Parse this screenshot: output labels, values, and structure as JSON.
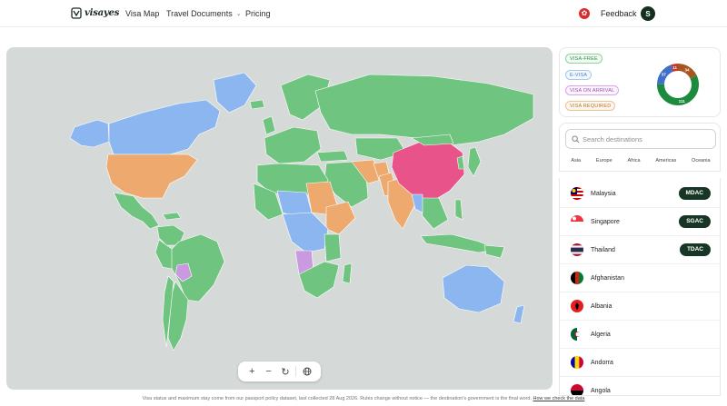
{
  "brand": {
    "name": "visayes"
  },
  "nav": {
    "links": [
      "Visa Map",
      "Travel Documents",
      "Pricing"
    ],
    "feedback": "Feedback",
    "avatar_initial": "S"
  },
  "legend": {
    "pills": [
      "VISA-FREE",
      "E-VISA",
      "VISA ON ARRIVAL",
      "VISA REQUIRED"
    ],
    "colors": {
      "visa_free": "#6fc47f",
      "e_visa": "#8bb6ef",
      "visa_on_arrival": "#c99ae0",
      "visa_required": "#eeaa6e",
      "selected": "#e8538a",
      "brown": "#a8551f"
    },
    "donut": [
      {
        "label": "34",
        "value": 34,
        "color": "#a8551f"
      },
      {
        "label": "111",
        "value": 111,
        "color": "#1e8a3e"
      },
      {
        "label": "37",
        "value": 37,
        "color": "#3e6fc9"
      },
      {
        "label": "11",
        "value": 11,
        "color": "#c0392b"
      }
    ]
  },
  "search": {
    "placeholder": "Search destinations"
  },
  "regions": [
    "Asia",
    "Europe",
    "Africa",
    "Americas",
    "Oceania"
  ],
  "destinations": [
    {
      "name": "Malaysia",
      "badge": "MDAC",
      "flag": "malaysia-flag-icon"
    },
    {
      "name": "Singapore",
      "badge": "SGAC",
      "flag": "singapore-flag-icon"
    },
    {
      "name": "Thailand",
      "badge": "TDAC",
      "flag": "thailand-flag-icon"
    },
    {
      "name": "Afghanistan",
      "badge": "",
      "flag": "afghanistan-flag-icon"
    },
    {
      "name": "Albania",
      "badge": "",
      "flag": "albania-flag-icon"
    },
    {
      "name": "Algeria",
      "badge": "",
      "flag": "algeria-flag-icon"
    },
    {
      "name": "Andorra",
      "badge": "",
      "flag": "andorra-flag-icon"
    },
    {
      "name": "Angola",
      "badge": "",
      "flag": "angola-flag-icon"
    }
  ],
  "footer": {
    "text": "Visa status and maximum stay come from our passport policy dataset, last collected 28 Aug 2026. Rules change without notice — the destination's government is the final word.",
    "link": "How we check the data"
  },
  "map_controls": [
    "zoom-in-icon",
    "zoom-out-icon",
    "reset-icon",
    "globe-icon"
  ]
}
